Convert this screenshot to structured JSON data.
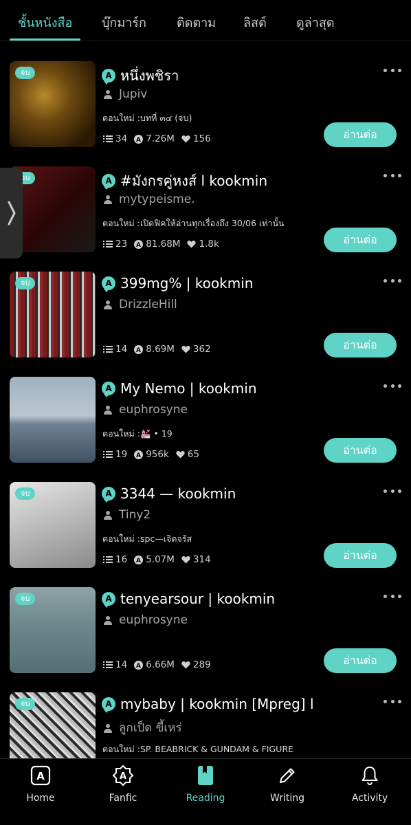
{
  "tabs": [
    {
      "label": "ชั้นหนังสือ",
      "active": true
    },
    {
      "label": "บุ๊กมาร์ก",
      "active": false
    },
    {
      "label": "ติดตาม",
      "active": false
    },
    {
      "label": "ลิสต์",
      "active": false
    },
    {
      "label": "ดูล่าสุด",
      "active": false
    }
  ],
  "read_button_label": "อ่านต่อ",
  "finished_badge": "จบ",
  "books": [
    {
      "title": "หนึ่งพชิรา",
      "author": "Jupiv",
      "update": "ตอนใหม่ :บทที่ ๓๔ (จบ)",
      "chapters": "34",
      "views": "7.26M",
      "likes": "156",
      "finished": true
    },
    {
      "title": "#มังกรคู่หงส์ l kookmin",
      "author": "mytypeisme.",
      "update": "ตอนใหม่ :เปิดฟิคให้อ่านทุกเรื่องถึง 30/06 เท่านั้น",
      "chapters": "23",
      "views": "81.68M",
      "likes": "1.8k",
      "finished": true
    },
    {
      "title": "399mg% | kookmin",
      "author": "DrizzleHill",
      "update": "",
      "chapters": "14",
      "views": "8.69M",
      "likes": "362",
      "finished": true
    },
    {
      "title": "My Nemo | kookmin",
      "author": "euphrosyne",
      "update": "ตอนใหม่ :💒 • 19",
      "chapters": "19",
      "views": "956k",
      "likes": "65",
      "finished": false
    },
    {
      "title": "3344 — kookmin",
      "author": "Tiny2",
      "update": "ตอนใหม่ :spc—เจิดจรัส",
      "chapters": "16",
      "views": "5.07M",
      "likes": "314",
      "finished": true
    },
    {
      "title": "tenyearsour | kookmin",
      "author": "euphrosyne",
      "update": "",
      "chapters": "14",
      "views": "6.66M",
      "likes": "289",
      "finished": true
    },
    {
      "title": "mybaby | kookmin [Mpreg] l",
      "author": "ลูกเป็ด ขี้เหร่",
      "update": "ตอนใหม่ :SP. BEABRICK & GUNDAM & FIGURE",
      "chapters": "",
      "views": "",
      "likes": "",
      "finished": true
    }
  ],
  "nav": [
    {
      "label": "Home",
      "icon": "home-a-icon",
      "active": false
    },
    {
      "label": "Fanfic",
      "icon": "fanfic-a-icon",
      "active": false
    },
    {
      "label": "Reading",
      "icon": "book-icon",
      "active": true
    },
    {
      "label": "Writing",
      "icon": "pencil-icon",
      "active": false
    },
    {
      "label": "Activity",
      "icon": "bell-icon",
      "active": false
    }
  ],
  "colors": {
    "accent": "#5fd3c6",
    "background": "#000000",
    "muted": "#a6a6a6"
  }
}
